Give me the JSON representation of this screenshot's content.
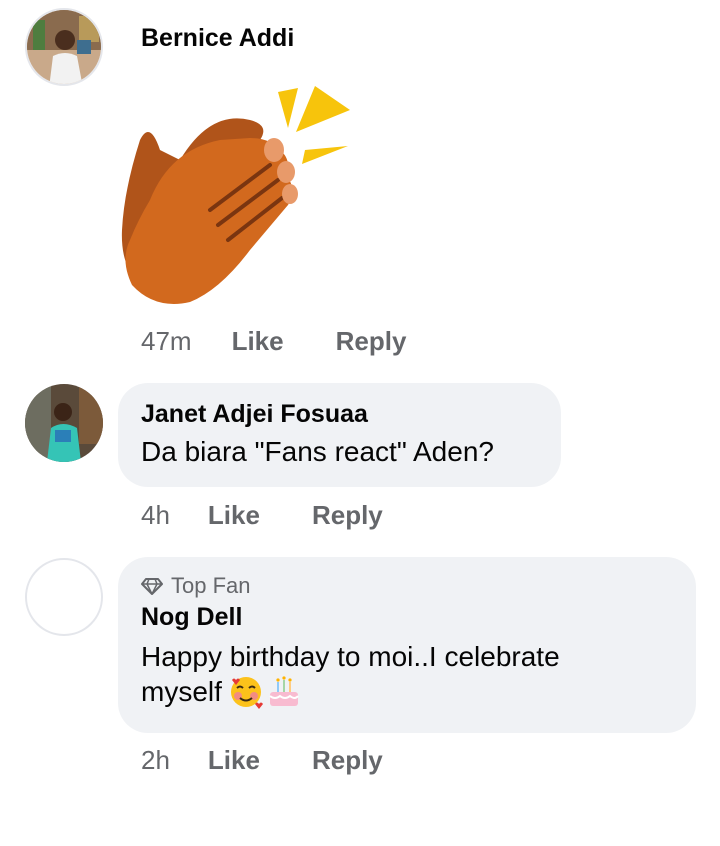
{
  "comments": [
    {
      "author": "Bernice Addi",
      "sticker": "clapping-hands-sticker",
      "time": "47m",
      "like_label": "Like",
      "reply_label": "Reply"
    },
    {
      "author": "Janet Adjei Fosuaa",
      "text": "Da biara \"Fans react\" Aden?",
      "time": "4h",
      "like_label": "Like",
      "reply_label": "Reply"
    },
    {
      "badge_icon": "diamond-icon",
      "badge": "Top Fan",
      "author": "Nog Dell",
      "text_line1": "Happy birthday to moi..I celebrate",
      "text_line2": "myself",
      "emojis": [
        "smiling-face-with-hearts-emoji",
        "birthday-cake-emoji"
      ],
      "time": "2h",
      "like_label": "Like",
      "reply_label": "Reply"
    }
  ],
  "colors": {
    "bubble": "#f0f2f5",
    "meta_text": "#65676b",
    "badge_text": "#65676b"
  }
}
